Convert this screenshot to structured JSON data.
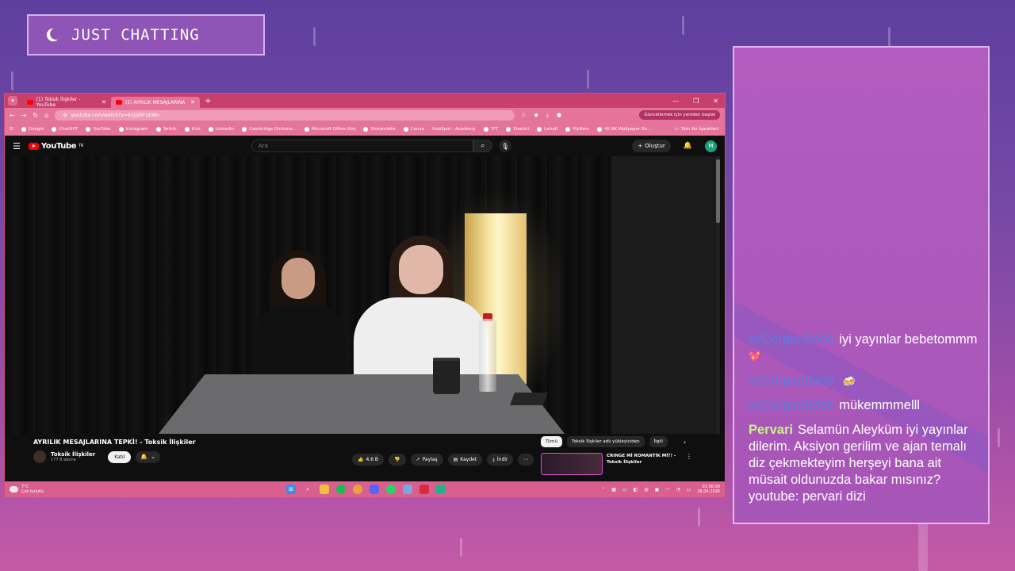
{
  "overlay": {
    "category": "JUST CHATTING"
  },
  "chat": {
    "messages": [
      {
        "user": "xxCorpseBride",
        "text": "iyi yayınlar bebetommm",
        "emoji": "💖"
      },
      {
        "user": "xxCorpseBride",
        "text": "",
        "emoji": "🍻"
      },
      {
        "user": "xxCorpseBride",
        "text": "mükemmmelll",
        "emoji": ""
      },
      {
        "user": "Pervari",
        "text": "Selamün Aleyküm iyi yayınlar dilerim. Aksiyon gerilim ve ajan temalı diz çekmekteyim herşeyi bana ait müsait oldunuzda bakar mısınız? youtube: pervari dizi",
        "emoji": ""
      }
    ]
  },
  "browser": {
    "tabs": [
      {
        "label": "(1) Toksik İlişkiler - YouTube"
      },
      {
        "label": "(1) AYRILIK MESAJLARINA"
      }
    ],
    "url": "youtube.com/watch?v=dnjqiNFUEWo",
    "update_label": "Güncellemek için yeniden başlat",
    "bookmarks": [
      "Google",
      "ChatGPT",
      "YouTube",
      "Instagram",
      "Twitch",
      "Kick",
      "LinkedIn",
      "Cambridge Dictiona...",
      "Microsoft Office Girş",
      "Streamlabs",
      "Canva",
      "HubSpot - Academy",
      "TFT",
      "Pixelmi",
      "lumafi",
      "MyNem",
      "4K 8K Wallpaper Ba...",
      "Tüm Yer İşaretleri"
    ]
  },
  "youtube": {
    "logo": "YouTube",
    "logo_sup": "TR",
    "search_placeholder": "Ara",
    "create_label": "Oluştur",
    "avatar_letter": "M",
    "video_title": "AYRILIK MESAJLARINA TEPKİ! - Toksik İlişkiler",
    "channel_name": "Toksik İlişkiler",
    "subscribers": "177 B abone",
    "join_label": "Katıl",
    "likes": "4,6 B",
    "share_label": "Paylaş",
    "save_label": "Kaydet",
    "download_label": "İndir",
    "chips": [
      "Tümü",
      "Toksik İlişkiler adlı yükleyiciden",
      "İlgili"
    ],
    "rec_title": "CRINGE Mİ ROMANTİK Mİ?! - Toksik İlişkiler"
  },
  "taskbar": {
    "temp": "7°C",
    "weather": "Çok bulutlu",
    "time": "01:56:09",
    "date": "26.04.2026"
  },
  "colors": {
    "accent": "#c93f6c",
    "chat_user_blue": "#5a7de0",
    "chat_user_green": "#c3f585"
  }
}
